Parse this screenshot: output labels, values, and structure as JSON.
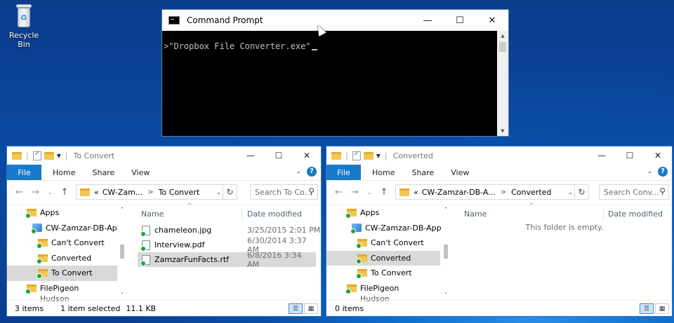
{
  "desktop": {
    "recycle_bin_label": "Recycle Bin"
  },
  "cmd": {
    "title": "Command Prompt",
    "text": ">\"Dropbox File Converter.exe\""
  },
  "window_controls": {
    "minimize": "—",
    "maximize": "☐",
    "close": "✕"
  },
  "ribbon": {
    "file": "File",
    "home": "Home",
    "share": "Share",
    "view": "View",
    "help": "?",
    "expand": "⌄"
  },
  "left": {
    "title": "To Convert",
    "address": {
      "prefix": "«",
      "crumb1": "CW-Zam...",
      "crumb2": "To Convert"
    },
    "search_placeholder": "Search To Co...",
    "tree": [
      {
        "label": "Apps"
      },
      {
        "label": "CW-Zamzar-DB-App"
      },
      {
        "label": "Can't Convert"
      },
      {
        "label": "Converted"
      },
      {
        "label": "To Convert"
      },
      {
        "label": "FilePigeon"
      },
      {
        "label": "Hudson"
      }
    ],
    "columns": {
      "name": "Name",
      "date": "Date modified"
    },
    "files": [
      {
        "name": "chameleon.jpg",
        "date": "3/25/2015 2:01 PM"
      },
      {
        "name": "Interview.pdf",
        "date": "6/30/2014 3:37 AM"
      },
      {
        "name": "ZamzarFunFacts.rtf",
        "date": "6/8/2016 3:34 AM"
      }
    ],
    "status": {
      "count": "3 items",
      "selected": "1 item selected",
      "size": "11.1 KB"
    }
  },
  "right": {
    "title": "Converted",
    "address": {
      "prefix": "«",
      "crumb1": "CW-Zamzar-DB-A...",
      "crumb2": "Converted"
    },
    "search_placeholder": "Search Conv...",
    "tree": [
      {
        "label": "Apps"
      },
      {
        "label": "CW-Zamzar-DB-App"
      },
      {
        "label": "Can't Convert"
      },
      {
        "label": "Converted"
      },
      {
        "label": "To Convert"
      },
      {
        "label": "FilePigeon"
      },
      {
        "label": "Hudson"
      }
    ],
    "columns": {
      "name": "Name",
      "date": "Date modified"
    },
    "empty_message": "This folder is empty.",
    "status": {
      "count": "0 items"
    }
  },
  "colors": {
    "accent": "#1979ca",
    "selection": "#d9d9d9",
    "sync_badge": "#1fa33a"
  }
}
